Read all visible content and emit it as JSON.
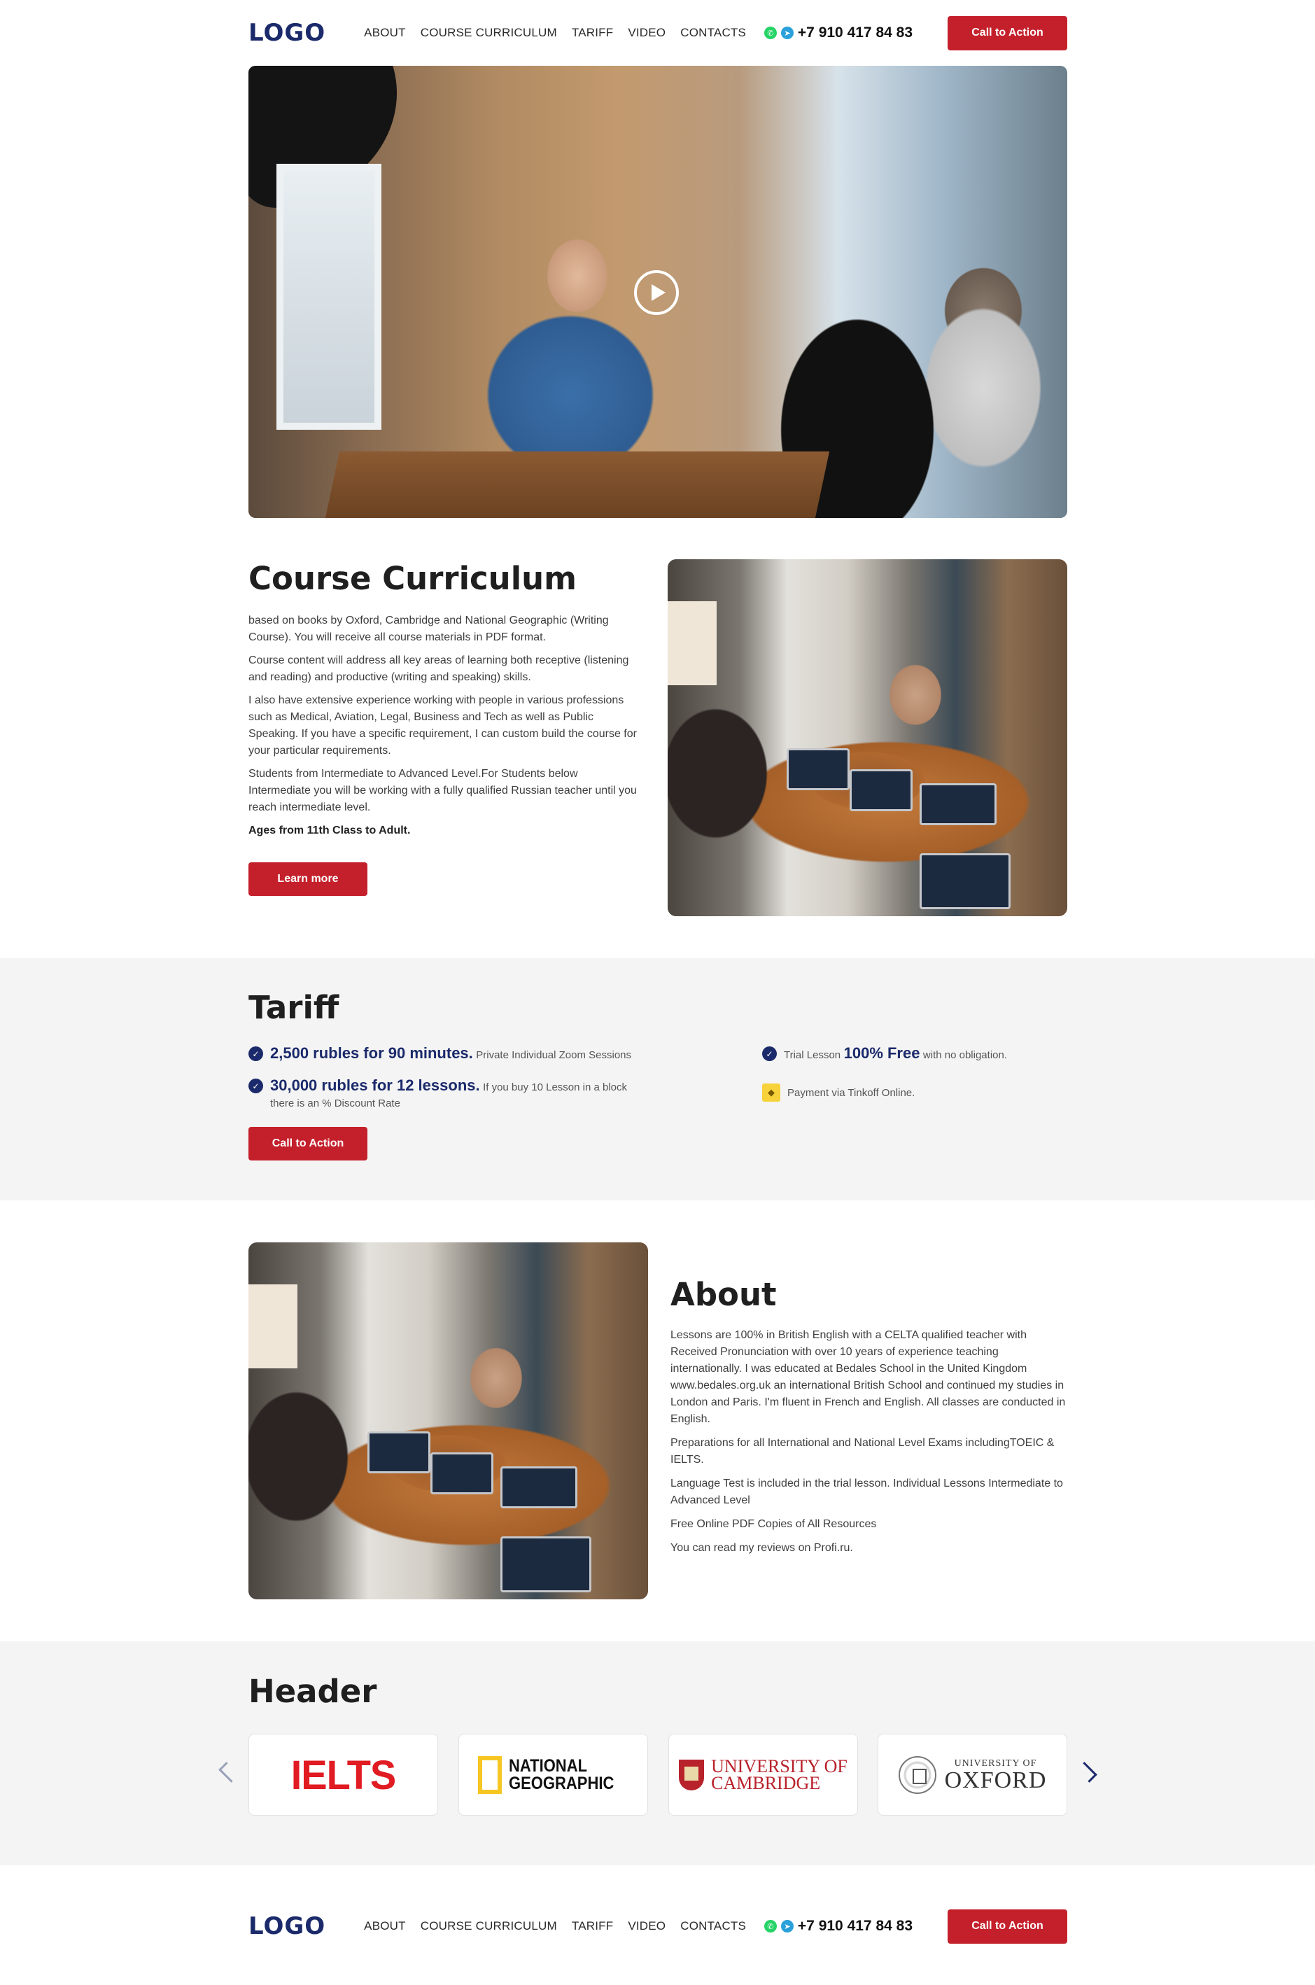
{
  "nav": {
    "logo": "LOGO",
    "menu": [
      "ABOUT",
      "COURSE CURRICULUM",
      "TARIFF",
      "VIDEO",
      "CONTACTS"
    ],
    "phone": "+7 910 417 84 83",
    "cta": "Call to Action",
    "icons": [
      "whatsapp-icon",
      "telegram-icon"
    ]
  },
  "hero": {
    "play_icon": "play-icon"
  },
  "course": {
    "title": "Course Curriculum",
    "paragraphs": [
      "based on books by Oxford, Cambridge and National Geographic (Writing Course). You will receive all course materials in PDF format.",
      "Course content will address all key areas of learning both receptive (listening and reading) and productive (writing and speaking) skills.",
      "I also have extensive experience working with people in various professions such as Medical, Aviation, Legal, Business and Tech as well as Public Speaking. If you have a specific requirement, I can custom build the course for your particular requirements.",
      "Students from Intermediate to Advanced Level.For Students below Intermediate you will be working with a fully qualified Russian teacher until you reach intermediate level."
    ],
    "ages": "Ages from 11th Class to Adult.",
    "button": "Learn more"
  },
  "tariff": {
    "title": "Tariff",
    "items": [
      {
        "big": "2,500 rubles for 90 minutes.",
        "small": "Private Individual Zoom Sessions"
      },
      {
        "big": "30,000 rubles for 12 lessons.",
        "small": "If you buy 10 Lesson in a block",
        "sub": "there is an % Discount Rate"
      }
    ],
    "trial": {
      "pre": "Trial Lesson",
      "big": "100% Free",
      "post": "with no obligation."
    },
    "payment": "Payment via Tinkoff Online.",
    "button": "Call to Action"
  },
  "about": {
    "title": "About",
    "paragraphs": [
      "Lessons are 100% in British English with a CELTA qualified teacher with Received Pronunciation with over 10 years of experience teaching internationally. I was educated at Bedales School in the United Kingdom www.bedales.org.uk an international British School and continued my studies in London and Paris. I'm fluent in French and English. All classes are conducted in English.",
      "Preparations for all International and National Level Exams includingTOEIC & IELTS.",
      "Language Test is included in the trial lesson. Individual Lessons Intermediate to Advanced Level",
      "Free Online PDF Copies of All Resources",
      "You can read my reviews on Profi.ru."
    ]
  },
  "partners": {
    "title": "Header",
    "ielts": "IELTS",
    "ng_line1": "NATIONAL",
    "ng_line2": "GEOGRAPHIC",
    "cam_line1": "UNIVERSITY OF",
    "cam_line2": "CAMBRIDGE",
    "ox_line1": "UNIVERSITY OF",
    "ox_line2": "OXFORD"
  },
  "colors": {
    "brand_navy": "#1b2a6b",
    "cta_red": "#c4202b",
    "band_gray": "#f4f4f4"
  }
}
